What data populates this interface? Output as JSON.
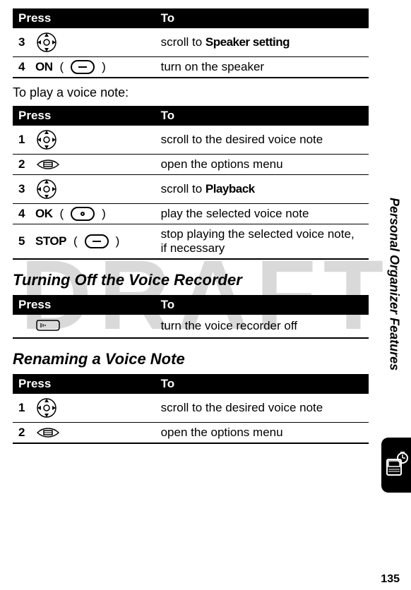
{
  "watermark": "DRAFT",
  "table1": {
    "head_press": "Press",
    "head_to": "To",
    "rows": [
      {
        "num": "3",
        "icon": "nav-4way-icon",
        "to_pre": "scroll to ",
        "to_bold": "Speaker setting"
      },
      {
        "num": "4",
        "label": "ON",
        "softkey": "dash",
        "to": "turn on the speaker"
      }
    ]
  },
  "play_intro": "To play a voice note:",
  "table2": {
    "head_press": "Press",
    "head_to": "To",
    "rows": [
      {
        "num": "1",
        "icon": "nav-4way-icon",
        "to": "scroll to the desired voice note"
      },
      {
        "num": "2",
        "icon": "menu-icon",
        "to": "open the options menu"
      },
      {
        "num": "3",
        "icon": "nav-4way-icon",
        "to_pre": "scroll to ",
        "to_bold": "Playback"
      },
      {
        "num": "4",
        "label": "OK",
        "softkey": "dot",
        "to": "play the selected voice note"
      },
      {
        "num": "5",
        "label": "STOP",
        "softkey": "dash",
        "to": "stop playing the selected voice note, if necessary"
      }
    ]
  },
  "heading_turnoff": "Turning Off the Voice Recorder",
  "table3": {
    "head_press": "Press",
    "head_to": "To",
    "rows": [
      {
        "icon": "voice-icon",
        "to": "turn the voice recorder off"
      }
    ]
  },
  "heading_rename": "Renaming a Voice Note",
  "table4": {
    "head_press": "Press",
    "head_to": "To",
    "rows": [
      {
        "num": "1",
        "icon": "nav-4way-icon",
        "to": "scroll to the desired voice note"
      },
      {
        "num": "2",
        "icon": "menu-icon",
        "to": "open the options menu"
      }
    ]
  },
  "side_label": "Personal Organizer Features",
  "page_number": "135"
}
